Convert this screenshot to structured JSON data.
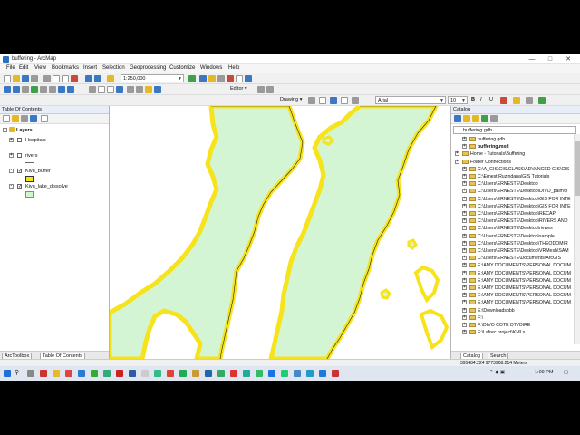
{
  "window": {
    "title": "buffering - ArcMap"
  },
  "window_controls": {
    "minimize": "—",
    "maximize": "□",
    "close": "✕"
  },
  "menu": [
    "File",
    "Edit",
    "View",
    "Bookmarks",
    "Insert",
    "Selection",
    "Geoprocessing",
    "Customize",
    "Windows",
    "Help"
  ],
  "toolbar": {
    "scale": "1:250,000",
    "editor_label": "Editor ▾",
    "drawing_label": "Drawing ▾",
    "font": "Arial",
    "font_size": "10"
  },
  "toc": {
    "title": "Table Of Contents",
    "root": "Layers",
    "layers": [
      {
        "name": "Hospitals",
        "checked": false
      },
      {
        "name": "rivers",
        "checked": false
      },
      {
        "name": "Kivu_buffer",
        "checked": true
      },
      {
        "name": "Kivu_lake_dissolve",
        "checked": true
      }
    ],
    "tabs": [
      "ArcToolbox",
      "Table Of Contents"
    ]
  },
  "catalog": {
    "title": "Catalog",
    "location_label": "Location:",
    "location": "buffering.gdb",
    "items": [
      {
        "text": "buffering.gdb",
        "level": 1,
        "bold": false
      },
      {
        "text": "buffering.mxd",
        "level": 1,
        "bold": true
      },
      {
        "text": "Home - Tutorials\\Buffering",
        "level": 0,
        "bold": false
      },
      {
        "text": "Folder Connections",
        "level": 0,
        "bold": false
      },
      {
        "text": "C:\\A_GIS\\GIS\\CLASS\\ADVANCED GIS\\GIS",
        "level": 1,
        "bold": false
      },
      {
        "text": "C:\\Ernest Ruzindana\\GIS Tutorials",
        "level": 1,
        "bold": false
      },
      {
        "text": "C:\\Users\\ERNESTE\\Desktop",
        "level": 1,
        "bold": false
      },
      {
        "text": "C:\\Users\\ERNESTE\\Desktop\\DIVO_palm\\p",
        "level": 1,
        "bold": false
      },
      {
        "text": "C:\\Users\\ERNESTE\\Desktop\\GIS FOR INTE",
        "level": 1,
        "bold": false
      },
      {
        "text": "C:\\Users\\ERNESTE\\Desktop\\GIS FOR INTE",
        "level": 1,
        "bold": false
      },
      {
        "text": "C:\\Users\\ERNESTE\\Desktop\\RECAP",
        "level": 1,
        "bold": false
      },
      {
        "text": "C:\\Users\\ERNESTE\\Desktop\\RIVERS AND",
        "level": 1,
        "bold": false
      },
      {
        "text": "C:\\Users\\ERNESTE\\Desktop\\rivwes",
        "level": 1,
        "bold": false
      },
      {
        "text": "C:\\Users\\ERNESTE\\Desktop\\sample",
        "level": 1,
        "bold": false
      },
      {
        "text": "C:\\Users\\ERNESTE\\Desktop\\THEODOMIR",
        "level": 1,
        "bold": false
      },
      {
        "text": "C:\\Users\\ERNESTE\\Desktop\\VRMesh\\SAM",
        "level": 1,
        "bold": false
      },
      {
        "text": "C:\\Users\\ERNESTE\\Documents\\ArcGIS",
        "level": 1,
        "bold": false
      },
      {
        "text": "E:\\AMY DOCUMENTS\\PERSONAL DOCUM",
        "level": 1,
        "bold": false
      },
      {
        "text": "E:\\AMY DOCUMENTS\\PERSONAL DOCUM",
        "level": 1,
        "bold": false
      },
      {
        "text": "E:\\AMY DOCUMENTS\\PERSONAL DOCUM",
        "level": 1,
        "bold": false
      },
      {
        "text": "E:\\AMY DOCUMENTS\\PERSONAL DOCUM",
        "level": 1,
        "bold": false
      },
      {
        "text": "E:\\AMY DOCUMENTS\\PERSONAL DOCUM",
        "level": 1,
        "bold": false
      },
      {
        "text": "E:\\AMY DOCUMENTS\\PERSONAL DOCUM",
        "level": 1,
        "bold": false
      },
      {
        "text": "E:\\Downloadsbbb",
        "level": 1,
        "bold": false
      },
      {
        "text": "F:\\",
        "level": 1,
        "bold": false
      },
      {
        "text": "F:\\DIVO COTE D'IVOIRE",
        "level": 1,
        "bold": false
      },
      {
        "text": "F:\\Lafrec project\\KMLs",
        "level": 1,
        "bold": false
      }
    ],
    "tabs": [
      "Catalog",
      "Search"
    ]
  },
  "status": {
    "coordinates": "395484.224  9773968.214 Meters"
  },
  "taskbar": {
    "clock": "1:09 PM"
  },
  "colors": {
    "land": "#ffffff",
    "lake": "#d4f5d4",
    "buffer": "#f6e31c",
    "outline": "#222222"
  }
}
